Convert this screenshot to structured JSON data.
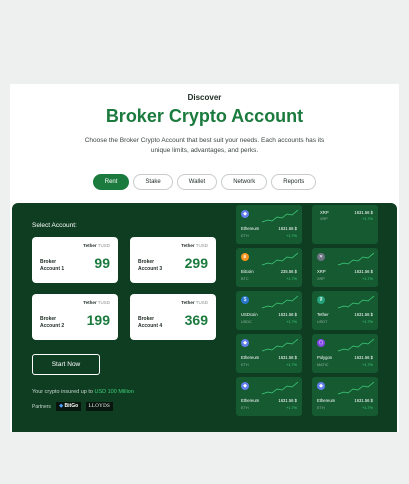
{
  "header": {
    "eyebrow": "Discover",
    "title": "Broker Crypto Account",
    "subtitle": "Choose the Broker Crypto Account that best suit your needs. Each accounts has its unique limits, advantages, and perks."
  },
  "tabs": [
    "Rent",
    "Stake",
    "Wallet",
    "Network",
    "Reports"
  ],
  "active_tab": "Rent",
  "panel": {
    "select_label": "Select Account:",
    "accounts": [
      {
        "token": "Tether",
        "unit": "TUSD",
        "name": "Broker Account 1",
        "value": "99"
      },
      {
        "token": "Tether",
        "unit": "TUSD",
        "name": "Broker Account 3",
        "value": "299"
      },
      {
        "token": "Tether",
        "unit": "TUSD",
        "name": "Broker Account 2",
        "value": "199"
      },
      {
        "token": "Tether",
        "unit": "TUSD",
        "name": "Broker Account 4",
        "value": "369"
      }
    ],
    "start_label": "Start Now",
    "insured_text": "Your crypto insured up to",
    "insured_amount": "USD 100 Million",
    "partners_label": "Partners",
    "partners": [
      "BitGo",
      "LLOYDS"
    ]
  },
  "coins_left": [
    {
      "name": "Ethereum",
      "symbol": "ETH",
      "price": "1631.56 $",
      "change": "+1.7%",
      "icon": "ethereum-icon",
      "color": "#627eea"
    },
    {
      "name": "Bitcoin",
      "symbol": "BTC",
      "price": "235.56 $",
      "change": "+1.7%",
      "icon": "bitcoin-icon",
      "color": "#f7931a"
    },
    {
      "name": "USDcoin",
      "symbol": "USDC",
      "price": "1631.56 $",
      "change": "+1.7%",
      "icon": "usdcoin-icon",
      "color": "#2775ca"
    },
    {
      "name": "Ethereum",
      "symbol": "ETH",
      "price": "1631.56 $",
      "change": "+1.7%",
      "icon": "ethereum-icon",
      "color": "#627eea"
    },
    {
      "name": "Ethereum",
      "symbol": "ETH",
      "price": "1631.56 $",
      "change": "+1.7%",
      "icon": "ethereum-icon",
      "color": "#627eea"
    }
  ],
  "coins_right": [
    {
      "name": "XRP",
      "symbol": "XRP",
      "price": "1631.56 $",
      "change": "+1.7%",
      "icon": "xrp-icon",
      "color": "#6b7280"
    },
    {
      "name": "XRP",
      "symbol": "XRP",
      "price": "1631.56 $",
      "change": "+1.7%",
      "icon": "xrp-icon",
      "color": "#6b7280"
    },
    {
      "name": "Tether",
      "symbol": "USDT",
      "price": "1631.56 $",
      "change": "+1.7%",
      "icon": "tether-icon",
      "color": "#26a17b"
    },
    {
      "name": "Polygon",
      "symbol": "MATIC",
      "price": "1631.56 $",
      "change": "+1.7%",
      "icon": "polygon-icon",
      "color": "#8247e5"
    },
    {
      "name": "Ethereum",
      "symbol": "ETH",
      "price": "1631.56 $",
      "change": "+1.7%",
      "icon": "ethereum-icon",
      "color": "#627eea"
    }
  ]
}
